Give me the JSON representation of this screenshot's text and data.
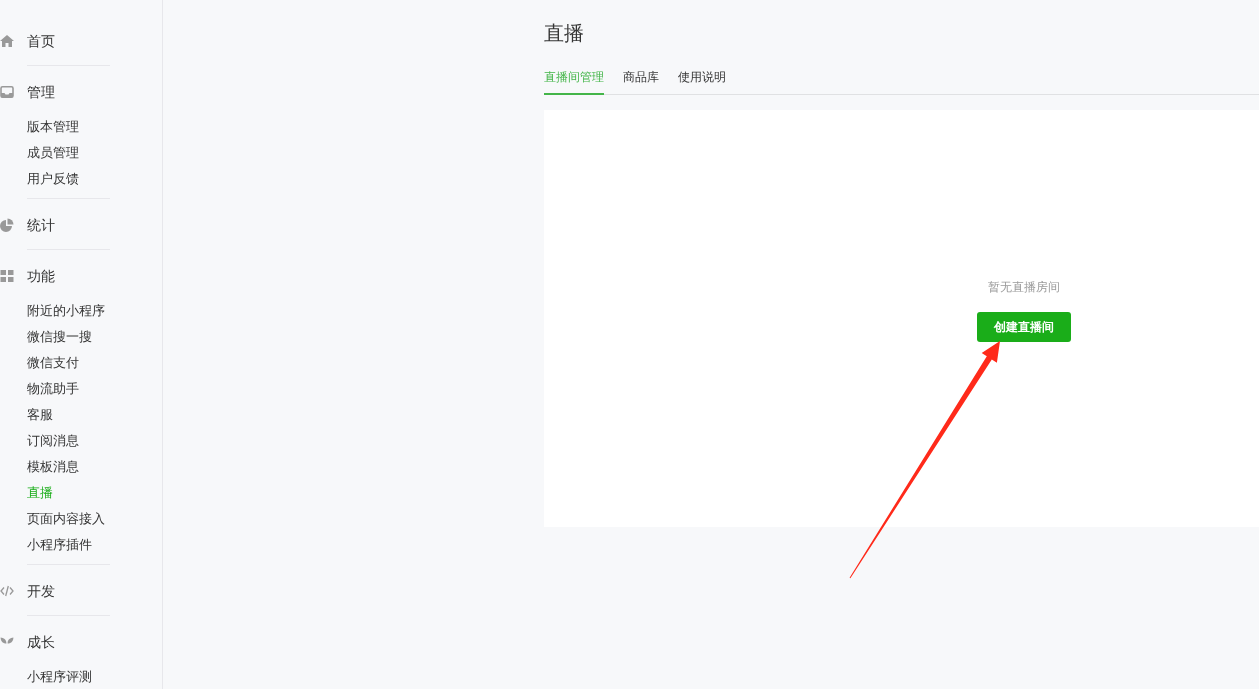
{
  "sidebar": {
    "sections": [
      {
        "label": "首页",
        "selected": false
      },
      {
        "label": "管理",
        "selected": false,
        "items": [
          {
            "label": "版本管理",
            "selected": false
          },
          {
            "label": "成员管理",
            "selected": false
          },
          {
            "label": "用户反馈",
            "selected": false
          }
        ]
      },
      {
        "label": "统计",
        "selected": false
      },
      {
        "label": "功能",
        "selected": false,
        "items": [
          {
            "label": "附近的小程序",
            "selected": false
          },
          {
            "label": "微信搜一搜",
            "selected": false
          },
          {
            "label": "微信支付",
            "selected": false
          },
          {
            "label": "物流助手",
            "selected": false
          },
          {
            "label": "客服",
            "selected": false
          },
          {
            "label": "订阅消息",
            "selected": false
          },
          {
            "label": "模板消息",
            "selected": false
          },
          {
            "label": "直播",
            "selected": true
          },
          {
            "label": "页面内容接入",
            "selected": false
          },
          {
            "label": "小程序插件",
            "selected": false
          }
        ]
      },
      {
        "label": "开发",
        "selected": false
      },
      {
        "label": "成长",
        "selected": false,
        "items": [
          {
            "label": "小程序评测",
            "selected": false
          }
        ]
      }
    ]
  },
  "page": {
    "title": "直播",
    "tabs": [
      {
        "label": "直播间管理",
        "selected": true
      },
      {
        "label": "商品库",
        "selected": false
      },
      {
        "label": "使用说明",
        "selected": false
      }
    ],
    "panel": {
      "empty_text": "暂无直播房间",
      "button": "创建直播间"
    }
  },
  "annotations": [
    {
      "kind": "arrow"
    }
  ]
}
